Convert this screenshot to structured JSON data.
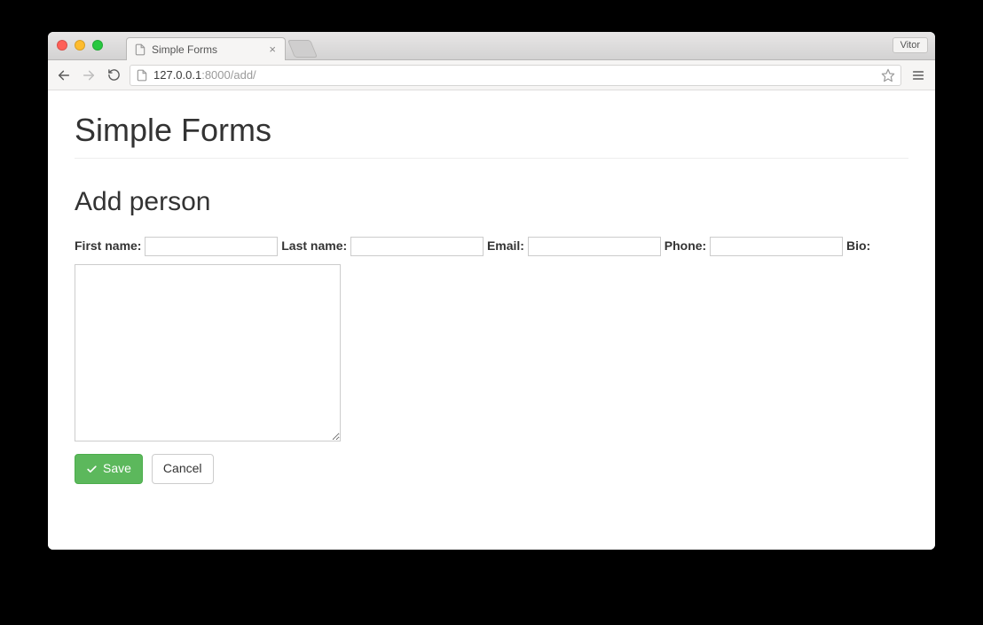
{
  "browser": {
    "tab_title": "Simple Forms",
    "profile_name": "Vitor",
    "url_host": "127.0.0.1",
    "url_port_path": ":8000/add/"
  },
  "page": {
    "title": "Simple Forms",
    "section_title": "Add person"
  },
  "form": {
    "first_name": {
      "label": "First name:",
      "value": ""
    },
    "last_name": {
      "label": "Last name:",
      "value": ""
    },
    "email": {
      "label": "Email:",
      "value": ""
    },
    "phone": {
      "label": "Phone:",
      "value": ""
    },
    "bio": {
      "label": "Bio:",
      "value": ""
    }
  },
  "actions": {
    "save_label": "Save",
    "cancel_label": "Cancel"
  }
}
